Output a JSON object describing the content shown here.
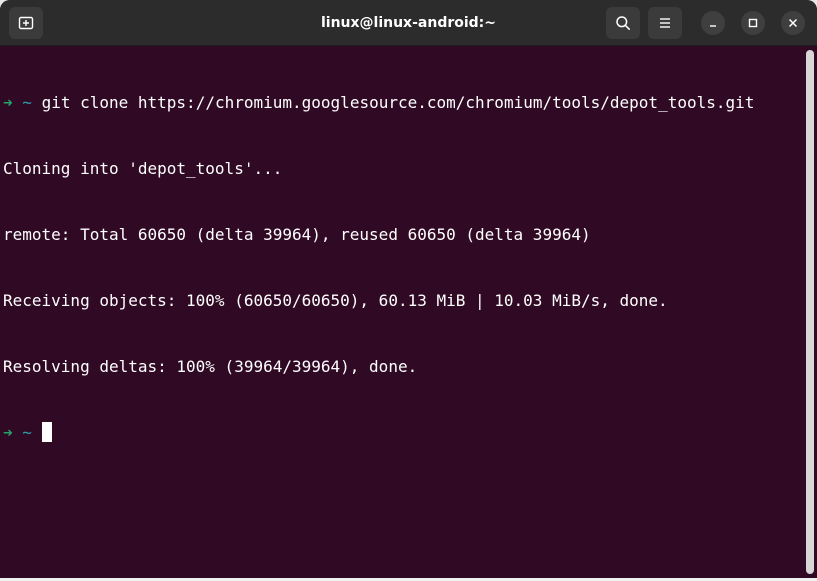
{
  "window": {
    "title": "linux@linux-android:~"
  },
  "icons": {
    "new_tab": "new-tab-icon",
    "search": "search-icon",
    "menu": "hamburger-menu-icon",
    "minimize": "minimize-icon",
    "maximize": "maximize-icon",
    "close": "close-icon"
  },
  "colors": {
    "terminal_bg": "#300a24",
    "titlebar_bg": "#2c2c2c",
    "prompt_arrow": "#26a269",
    "prompt_dir": "#2aa1b3",
    "text": "#ffffff"
  },
  "terminal": {
    "prompt_arrow": "➜",
    "prompt_dir": "~",
    "command": "git clone https://chromium.googlesource.com/chromium/tools/depot_tools.git",
    "output": [
      "Cloning into 'depot_tools'...",
      "remote: Total 60650 (delta 39964), reused 60650 (delta 39964)",
      "Receiving objects: 100% (60650/60650), 60.13 MiB | 10.03 MiB/s, done.",
      "Resolving deltas: 100% (39964/39964), done."
    ]
  }
}
